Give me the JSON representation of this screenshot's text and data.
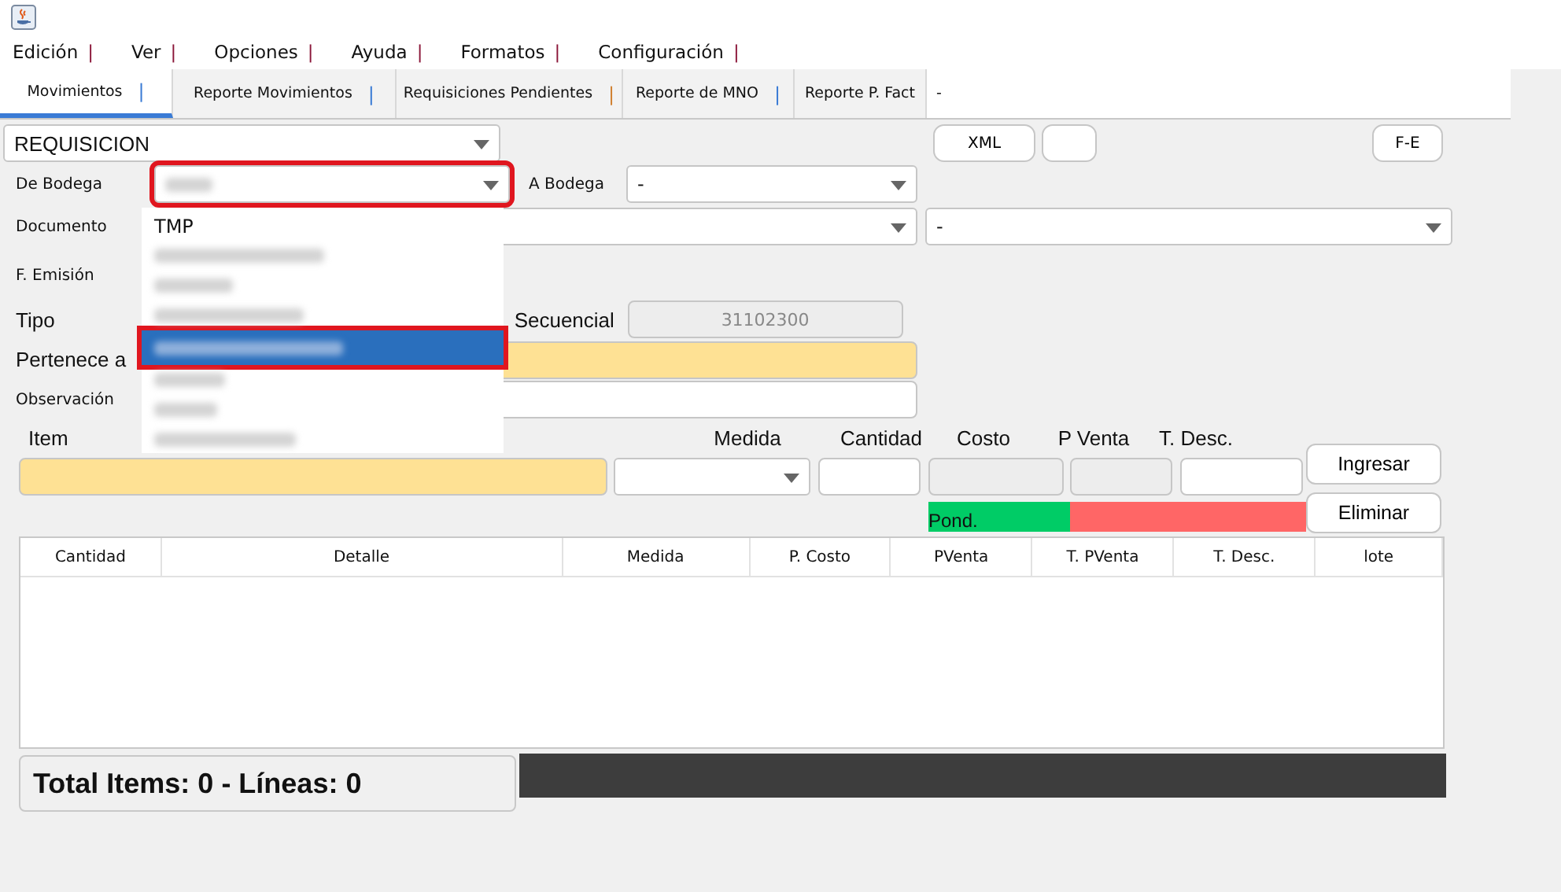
{
  "menu": [
    {
      "label": "Edición"
    },
    {
      "label": "Ver"
    },
    {
      "label": "Opciones"
    },
    {
      "label": "Ayuda"
    },
    {
      "label": "Formatos"
    },
    {
      "label": "Configuración"
    }
  ],
  "menu_separator": "|",
  "tabs": [
    {
      "label": "Movimientos",
      "sep": "|",
      "selected": true
    },
    {
      "label": "Reporte Movimientos",
      "sep": "|",
      "selected": false
    },
    {
      "label": "Requisiciones Pendientes",
      "sep": "|",
      "selected": false
    },
    {
      "label": "Reporte de MNO",
      "sep": "|",
      "selected": false
    },
    {
      "label": "Reporte P. Fact",
      "selected": false
    }
  ],
  "tabs_trailing": "-",
  "type_combo": {
    "value": "REQUISICION"
  },
  "buttons_top": [
    {
      "label": "XML"
    }
  ],
  "blank_button": true,
  "fe_button": "F-E",
  "de_bodega": {
    "label": "De Bodega",
    "blurred_value": true,
    "outlined": true
  },
  "a_bodega": {
    "label": "A Bodega",
    "value": "-"
  },
  "documento": {
    "label": "Documento",
    "second_value": "-"
  },
  "f_emision": {
    "label": "F. Emisión"
  },
  "tipo": {
    "label": "Tipo"
  },
  "secuencial": {
    "label": "Secuencial",
    "value": "31102300"
  },
  "pertenece": {
    "label": "Pertenece a"
  },
  "observacion": {
    "label": "Observación"
  },
  "item_labels": [
    {
      "label": "Item"
    },
    {
      "label": "Medida"
    },
    {
      "label": "Cantidad"
    },
    {
      "label": "Costo"
    },
    {
      "label": "P Venta"
    },
    {
      "label": "T. Desc."
    }
  ],
  "ingresar": "Ingresar",
  "eliminar": "Eliminar",
  "pond": [
    {
      "text": "Pond.",
      "color": "#00cc66"
    },
    {
      "color": "#ff6666"
    }
  ],
  "table": {
    "columns": [
      "Cantidad",
      "Detalle",
      "Medida",
      "P. Costo",
      "PVenta",
      "T. PVenta",
      "T. Desc.",
      "lote"
    ]
  },
  "total": "Total Items: 0 - Líneas: 0",
  "dropdown": [
    {
      "kind": "text",
      "text": "TMP",
      "selected": false,
      "outlined": false
    },
    {
      "kind": "blurred",
      "selected": false,
      "outlined": false
    },
    {
      "kind": "blurred",
      "selected": false,
      "outlined": false
    },
    {
      "kind": "blurred",
      "selected": false,
      "outlined": false
    },
    {
      "kind": "blurred",
      "selected": true,
      "outlined": true
    },
    {
      "kind": "blurred",
      "selected": false,
      "outlined": false
    },
    {
      "kind": "blurred",
      "selected": false,
      "outlined": false
    },
    {
      "kind": "blurred",
      "selected": false,
      "outlined": false
    }
  ]
}
